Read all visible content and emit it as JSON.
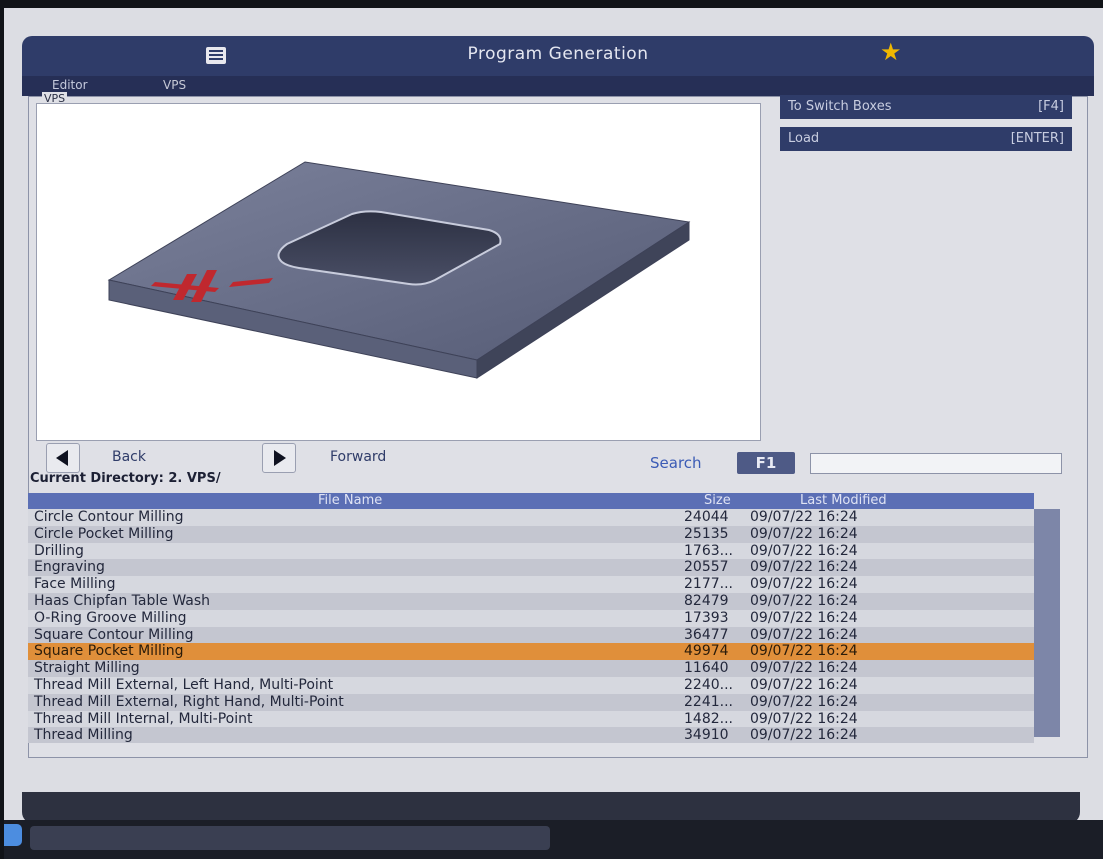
{
  "app": {
    "title": "Program Generation",
    "tabs": [
      "Editor",
      "VPS"
    ],
    "active_tab": "VPS"
  },
  "panel": {
    "label": "VPS"
  },
  "side_buttons": [
    {
      "label": "To Switch Boxes",
      "key": "[F4]"
    },
    {
      "label": "Load",
      "key": "[ENTER]"
    }
  ],
  "nav": {
    "back_label": "Back",
    "forward_label": "Forward"
  },
  "search": {
    "label": "Search",
    "key": "F1",
    "value": ""
  },
  "directory": {
    "label": "Current Directory: 2. VPS/"
  },
  "table": {
    "columns": [
      "File Name",
      "Size",
      "Last Modified"
    ],
    "rows": [
      {
        "name": "Circle Contour Milling",
        "size": "24044",
        "modified": "09/07/22 16:24"
      },
      {
        "name": "Circle Pocket Milling",
        "size": "25135",
        "modified": "09/07/22 16:24"
      },
      {
        "name": "Drilling",
        "size": "1763...",
        "modified": "09/07/22 16:24"
      },
      {
        "name": "Engraving",
        "size": "20557",
        "modified": "09/07/22 16:24"
      },
      {
        "name": "Face Milling",
        "size": "2177...",
        "modified": "09/07/22 16:24"
      },
      {
        "name": "Haas Chipfan Table Wash",
        "size": "82479",
        "modified": "09/07/22 16:24"
      },
      {
        "name": "O-Ring Groove Milling",
        "size": "17393",
        "modified": "09/07/22 16:24"
      },
      {
        "name": "Square Contour Milling",
        "size": "36477",
        "modified": "09/07/22 16:24"
      },
      {
        "name": "Square Pocket Milling",
        "size": "49974",
        "modified": "09/07/22 16:24"
      },
      {
        "name": "Straight Milling",
        "size": "11640",
        "modified": "09/07/22 16:24"
      },
      {
        "name": "Thread Mill External, Left Hand, Multi-Point",
        "size": "2240...",
        "modified": "09/07/22 16:24"
      },
      {
        "name": "Thread Mill External, Right Hand, Multi-Point",
        "size": "2241...",
        "modified": "09/07/22 16:24"
      },
      {
        "name": "Thread Mill Internal, Multi-Point",
        "size": "1482...",
        "modified": "09/07/22 16:24"
      },
      {
        "name": "Thread Milling",
        "size": "34910",
        "modified": "09/07/22 16:24"
      }
    ],
    "selected_index": 8
  },
  "colors": {
    "header_bar": "#2f3c69",
    "table_header": "#5b6fb5",
    "selected_row": "#e08f3a",
    "star": "#f0b800",
    "logo_red": "#c0282e"
  },
  "icons": [
    "menu-icon",
    "star-icon",
    "back-arrow-icon",
    "forward-arrow-icon"
  ]
}
